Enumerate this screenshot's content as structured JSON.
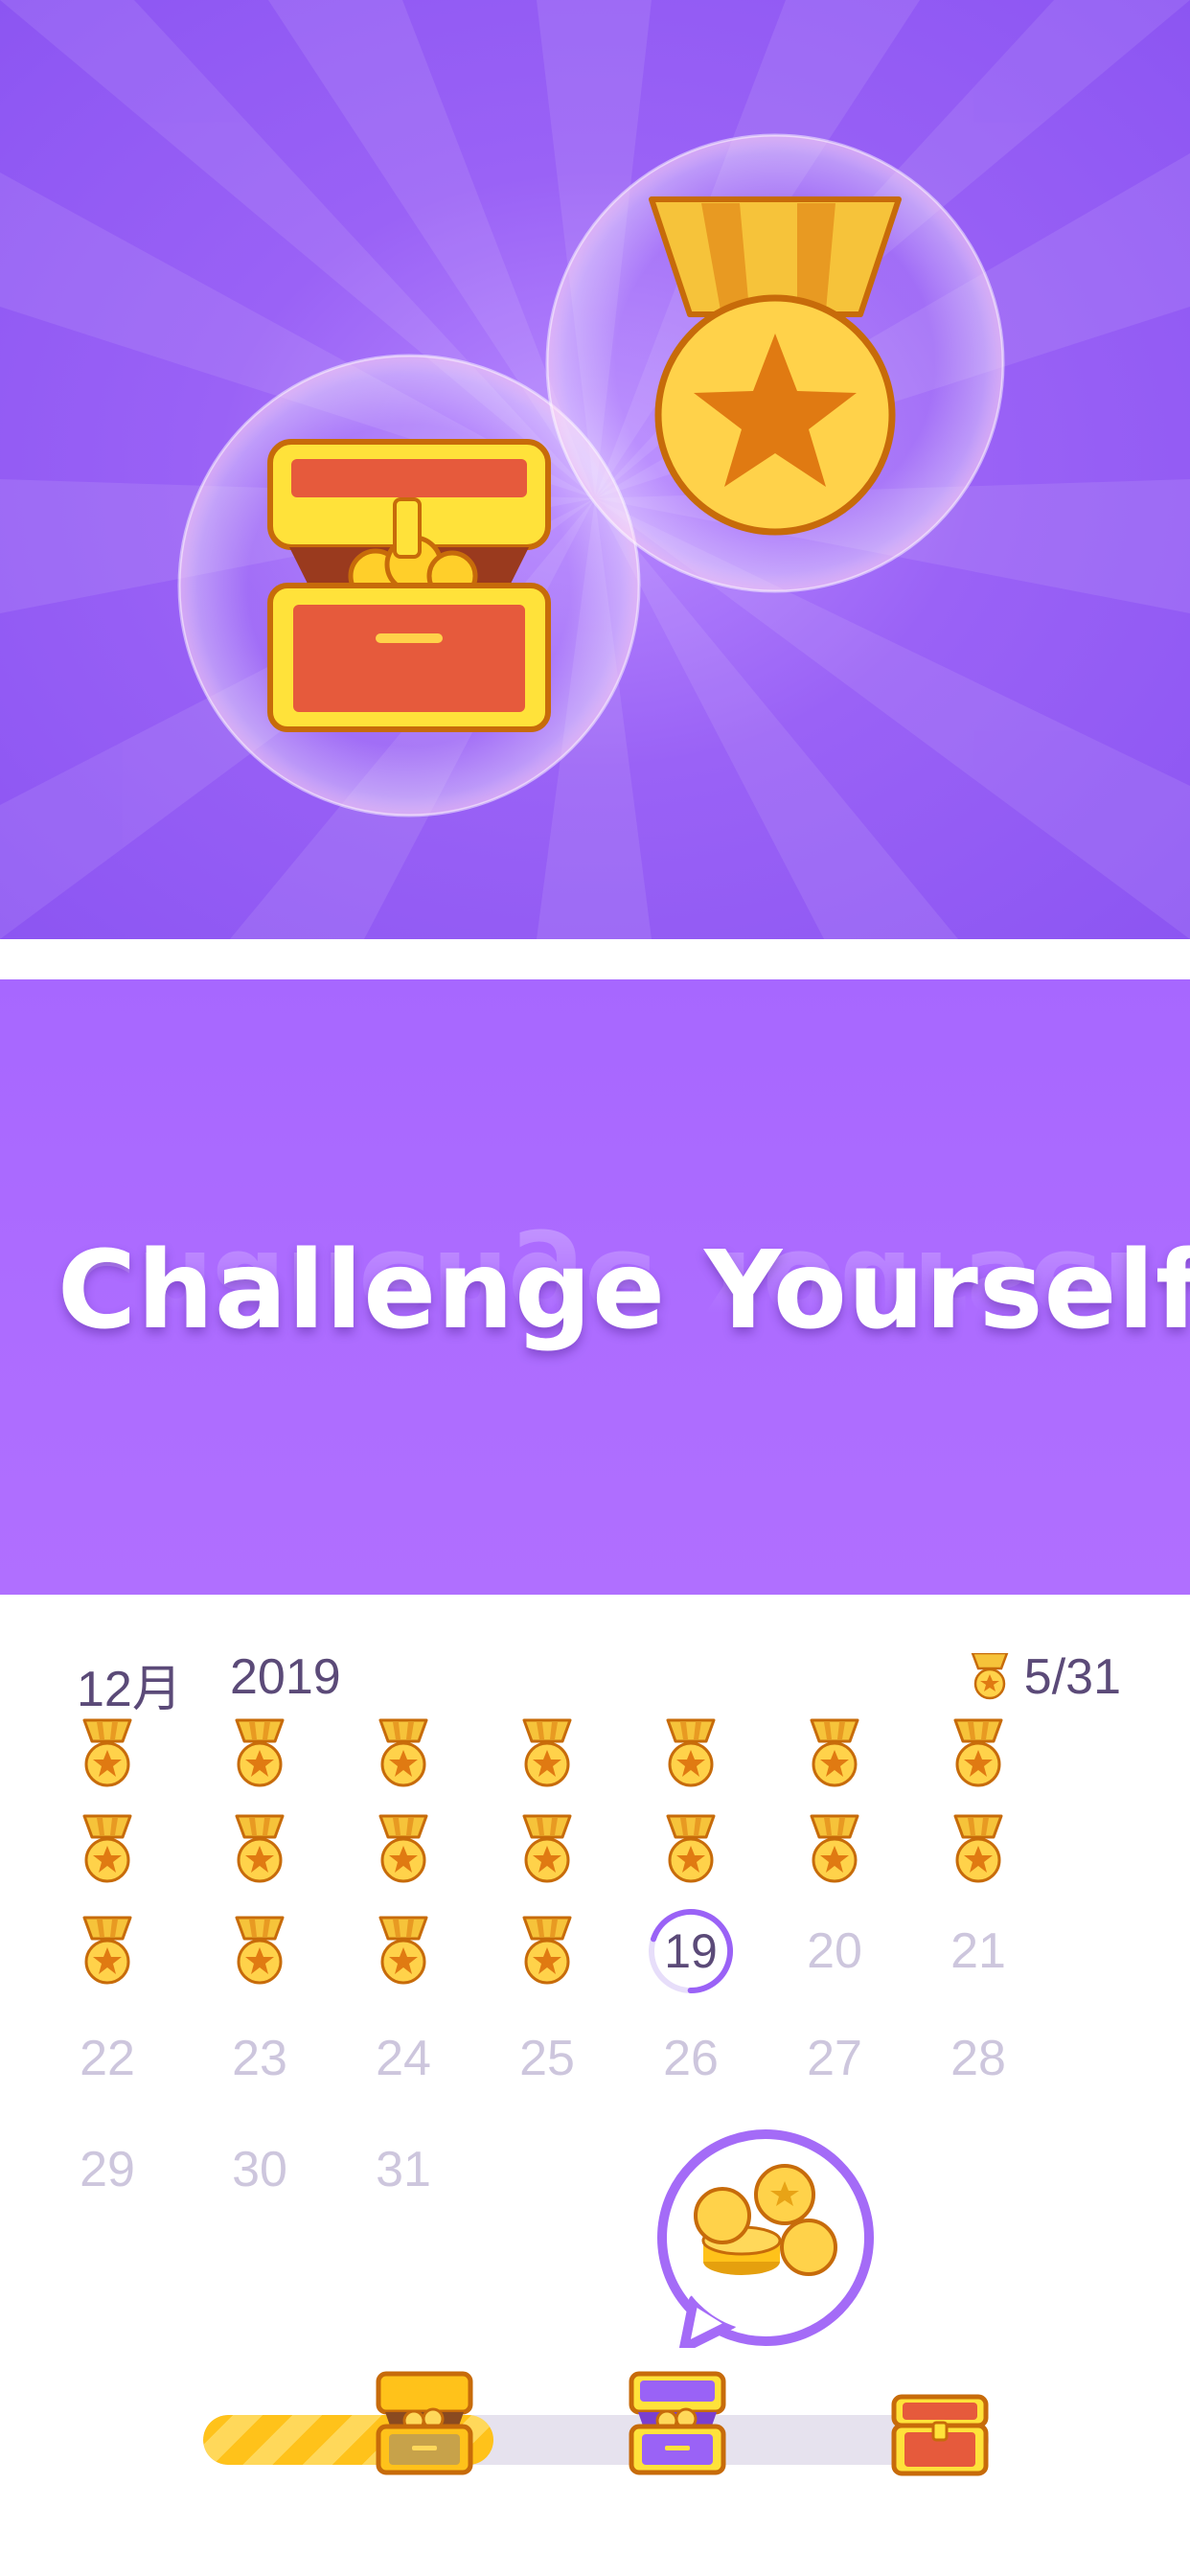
{
  "hero": {
    "icons": [
      "treasure-chest-icon",
      "medal-icon"
    ],
    "colors": {
      "bg": "#9a62f6",
      "bubble": "#ffffff",
      "gold": "#f6c33a",
      "orange": "#e07a12",
      "red": "#e65a3c"
    }
  },
  "banner": {
    "title": "Challenge Yourself"
  },
  "calendar": {
    "month": "12月",
    "year": "2019",
    "progress": "5/31",
    "completed_icon": "medal-icon",
    "completed_days": [
      1,
      2,
      3,
      4,
      5,
      6,
      7,
      8,
      9,
      10,
      11,
      12,
      13,
      14,
      15,
      16,
      17,
      18
    ],
    "today": "19",
    "today_progress_fraction": 0.3,
    "rows": [
      [
        "",
        "",
        "",
        "",
        "",
        "",
        ""
      ],
      [
        "",
        "",
        "",
        "",
        "",
        "",
        ""
      ],
      [
        "",
        "",
        "",
        "",
        "19",
        "20",
        "21"
      ],
      [
        "22",
        "23",
        "24",
        "25",
        "26",
        "27",
        "28"
      ],
      [
        "29",
        "30",
        "31"
      ]
    ]
  },
  "reward_popup": {
    "icon": "coins-pile-icon"
  },
  "reward_progress": {
    "fill_fraction": 0.37,
    "milestones": [
      "chest-opened-gold-icon",
      "chest-opened-purple-icon",
      "chest-closed-red-icon"
    ]
  }
}
